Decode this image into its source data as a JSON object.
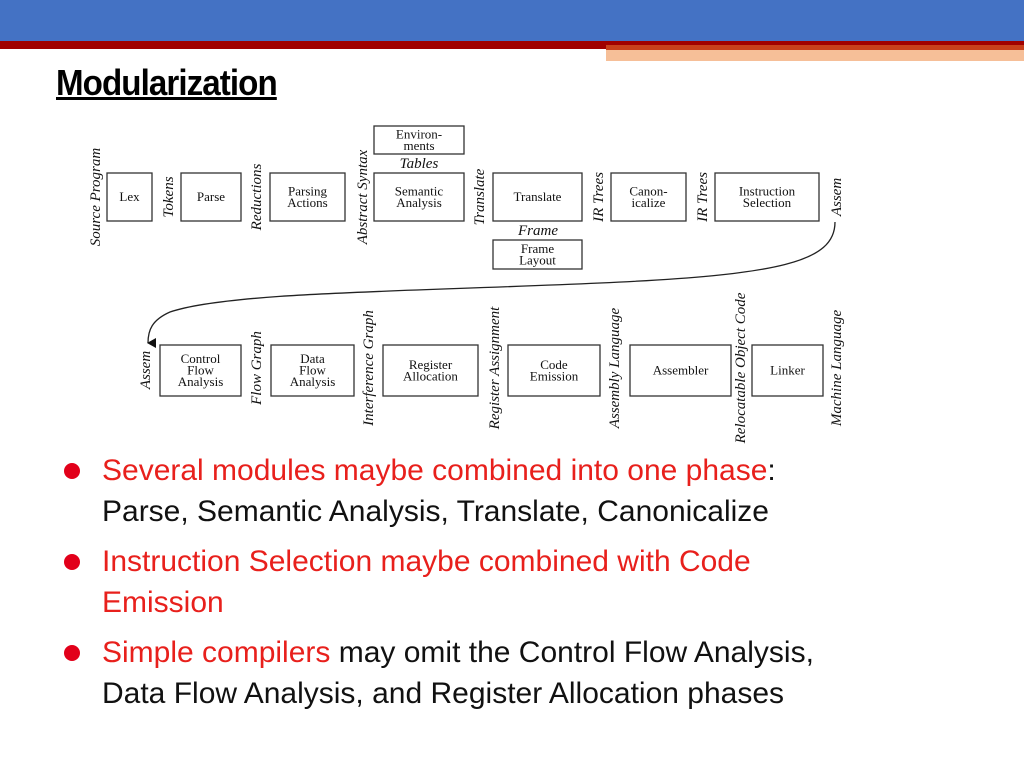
{
  "title": "Modularization",
  "diagram": {
    "row1_boxes": [
      "Lex",
      "Parse",
      "Parsing|Actions",
      "Semantic|Analysis",
      "Translate",
      "Canon-|icalize",
      "Instruction|Selection"
    ],
    "row1_labels": [
      "Source Program",
      "Tokens",
      "Reductions",
      "Abstract Syntax",
      "Translate",
      "IR Trees",
      "IR Trees",
      "Assem"
    ],
    "environments_box": "Environ-|ments",
    "tables_label": "Tables",
    "frame_label": "Frame",
    "frame_layout_box": "Frame|Layout",
    "row2_boxes": [
      "Control|Flow|Analysis",
      "Data|Flow|Analysis",
      "Register|Allocation",
      "Code|Emission",
      "Assembler",
      "Linker"
    ],
    "row2_labels": [
      "Assem",
      "Flow Graph",
      "Interference Graph",
      "Register Assignment",
      "Assembly Language",
      "Relocatable Object Code",
      "Machine Language"
    ]
  },
  "bullets": [
    {
      "red": "Several modules maybe combined into one phase",
      "black": ":",
      "line2": "Parse, Semantic Analysis, Translate, Canonicalize"
    },
    {
      "red": "Instruction Selection maybe combined with Code",
      "black": "",
      "line2_red": "Emission"
    },
    {
      "red": "Simple compilers",
      "black": " may omit the Control Flow Analysis,",
      "line2": "Data Flow Analysis, and Register Allocation phases"
    }
  ],
  "colors": {
    "header_blue": "#4472c4",
    "header_red": "#a00000",
    "accent_orange": "#f6bf98",
    "bullet_red": "#e8201c"
  }
}
